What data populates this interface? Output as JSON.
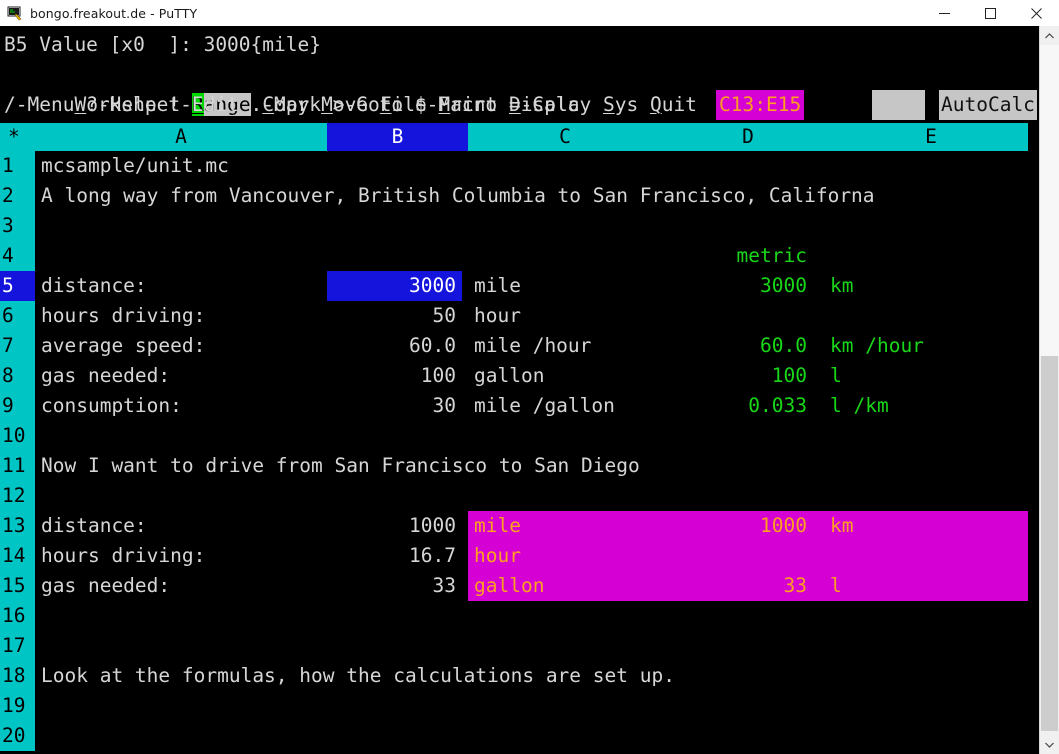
{
  "window": {
    "title": "bongo.freakout.de - PuTTY",
    "icon": "putty-icon",
    "buttons": [
      {
        "name": "minimize-button",
        "glyph": "minimize-icon"
      },
      {
        "name": "maximize-button",
        "glyph": "maximize-icon"
      },
      {
        "name": "close-button",
        "glyph": "close-icon"
      }
    ]
  },
  "colors": {
    "terminal_bg": "#000000",
    "terminal_fg": "#d6d6d6",
    "header_cyan": "#00c5c5",
    "selection_blue": "#1414dc",
    "selection_magenta": "#d400d4",
    "metric_green": "#18d718",
    "magenta_text_orange": "#ffa020",
    "menu_highlight": "#c6c6c6",
    "menu_key_green": "#00d700"
  },
  "statusline": {
    "cell_ref": "B5",
    "mode": "Value",
    "format": "[x0  ]",
    "separator": ":",
    "content": "3000{mile}",
    "full": "B5 Value [x0  ]: 3000{mile}"
  },
  "menu": {
    "items": [
      {
        "label": "Worksheet",
        "key": "W",
        "rest": "orksheet",
        "selected": false
      },
      {
        "label": "Range",
        "key": "R",
        "rest": "ange",
        "selected": true
      },
      {
        "label": "Copy",
        "key": "C",
        "rest": "opy",
        "selected": false
      },
      {
        "label": "Move",
        "key": "M",
        "rest": "ove",
        "selected": false
      },
      {
        "label": "File",
        "key": "F",
        "rest": "ile",
        "selected": false
      },
      {
        "label": "Print",
        "key": "P",
        "rest": "rint",
        "selected": false
      },
      {
        "label": "Display",
        "key": "D",
        "rest": "isplay",
        "selected": false
      },
      {
        "label": "Sys",
        "key": "S",
        "rest": "ys",
        "selected": false
      },
      {
        "label": "Quit",
        "key": "Q",
        "rest": "uit",
        "selected": false
      }
    ]
  },
  "helpline": {
    "text": "/-Menu ?-Help !-Edit .-Mark >-Goto $-Macro =-Calc",
    "range_badge": "C13:E15",
    "blank_badge": "",
    "autocalc": "AutoCalc"
  },
  "grid": {
    "columns": [
      {
        "label": "*",
        "selected": false
      },
      {
        "label": "A",
        "selected": false
      },
      {
        "label": "B",
        "selected": true
      },
      {
        "label": "C",
        "selected": false
      },
      {
        "label": "D",
        "selected": false
      },
      {
        "label": "E",
        "selected": false
      }
    ],
    "rows": [
      {
        "num": "1",
        "selected": false
      },
      {
        "num": "2",
        "selected": false
      },
      {
        "num": "3",
        "selected": false
      },
      {
        "num": "4",
        "selected": false
      },
      {
        "num": "5",
        "selected": true
      },
      {
        "num": "6",
        "selected": false
      },
      {
        "num": "7",
        "selected": false
      },
      {
        "num": "8",
        "selected": false
      },
      {
        "num": "9",
        "selected": false
      },
      {
        "num": "10",
        "selected": false
      },
      {
        "num": "11",
        "selected": false
      },
      {
        "num": "12",
        "selected": false
      },
      {
        "num": "13",
        "selected": false
      },
      {
        "num": "14",
        "selected": false
      },
      {
        "num": "15",
        "selected": false
      },
      {
        "num": "16",
        "selected": false
      },
      {
        "num": "17",
        "selected": false
      },
      {
        "num": "18",
        "selected": false
      },
      {
        "num": "19",
        "selected": false
      },
      {
        "num": "20",
        "selected": false
      }
    ],
    "cells": {
      "r1": {
        "a": "mcsample/unit.mc"
      },
      "r2": {
        "a": "A long way from Vancouver, British Columbia to San Francisco, Californa"
      },
      "r4": {
        "d": "metric"
      },
      "r5": {
        "a": "distance:",
        "b": "3000",
        "c": "mile",
        "d": "3000",
        "e": "km"
      },
      "r6": {
        "a": "hours driving:",
        "b": "50",
        "c": "hour",
        "d": "",
        "e": ""
      },
      "r7": {
        "a": "average speed:",
        "b": "60.0",
        "c": "mile /hour",
        "d": "60.0",
        "e": "km /hour"
      },
      "r8": {
        "a": "gas needed:",
        "b": "100",
        "c": "gallon",
        "d": "100",
        "e": "l"
      },
      "r9": {
        "a": "consumption:",
        "b": "30",
        "c": "mile /gallon",
        "d": "0.033",
        "e": "l /km"
      },
      "r11": {
        "a": "Now I want to drive from San Francisco to San Diego"
      },
      "r13": {
        "a": "distance:",
        "b": "1000",
        "c": "mile",
        "d": "1000",
        "e": "km"
      },
      "r14": {
        "a": "hours driving:",
        "b": "16.7",
        "c": "hour",
        "d": "",
        "e": ""
      },
      "r15": {
        "a": "gas needed:",
        "b": "33",
        "c": "gallon",
        "d": "33",
        "e": "l"
      },
      "r18": {
        "a": "Look at the formulas, how the calculations are set up."
      }
    }
  },
  "scrollbar": {
    "up_arrow": "chevron-up-icon",
    "down_arrow": "chevron-down-icon"
  }
}
